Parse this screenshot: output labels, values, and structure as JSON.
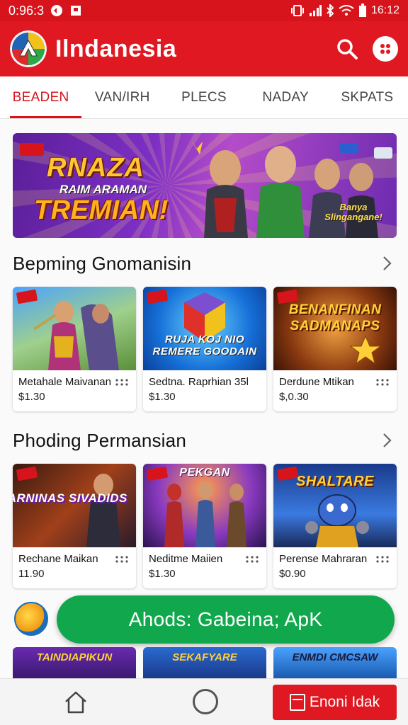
{
  "status_bar": {
    "time_left": "0:96:3",
    "time_right": "16:12"
  },
  "app": {
    "title": "Ilndanesia",
    "accent": "#e01822",
    "icons": [
      "search-icon",
      "menu-dots-icon"
    ]
  },
  "tabs": [
    {
      "label": "BEADEN",
      "active": true
    },
    {
      "label": "VAN/IRH",
      "active": false
    },
    {
      "label": "PLECS",
      "active": false
    },
    {
      "label": "NADAY",
      "active": false
    },
    {
      "label": "SKPATS",
      "active": false
    }
  ],
  "banner": {
    "line1": "RNAZA",
    "line2": "RAIM ARAMAN",
    "line3": "TREMIAN!",
    "tag": "Banya Slingangane!"
  },
  "sections": [
    {
      "title": "Bepming Gnomanisin",
      "cards": [
        {
          "name": "Metahale Maivanan",
          "price": "$1.30",
          "thumb_text": ""
        },
        {
          "name": "Sedtna. Raprhian 35l",
          "price": "$1.30",
          "thumb_text": "RUJA KOJ NIO REMERE GOODAIN"
        },
        {
          "name": "Derdune Mtikan",
          "price": "$,0.30",
          "thumb_text": "BENANFINAN SADMANAPS"
        }
      ]
    },
    {
      "title": "Phoding Permansian",
      "cards": [
        {
          "name": "Rechane Maikan",
          "price": "11.90",
          "thumb_text": "PARNINAS SIVADIDS"
        },
        {
          "name": "Neditme Maiien",
          "price": "$1.30",
          "thumb_text": "PEKGAN"
        },
        {
          "name": "Perense Mahraran",
          "price": "$0.90",
          "thumb_text": "SHALTARE"
        }
      ]
    }
  ],
  "promo": {
    "label": "Ahods: Gabeina; ApK"
  },
  "peek_cards": [
    {
      "text": "TAINDIAPIKUN"
    },
    {
      "text": "SEKAFYARE"
    },
    {
      "text": "ENMDI CMCSAW"
    }
  ],
  "bottom_nav": {
    "cta_label": "Enoni  Idak"
  }
}
